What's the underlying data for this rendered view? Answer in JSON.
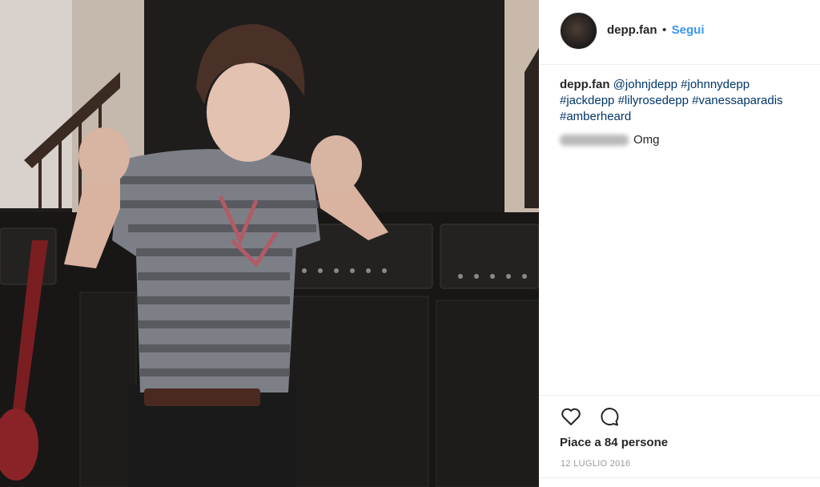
{
  "post": {
    "username": "depp.fan",
    "separator": "•",
    "follow_label": "Segui"
  },
  "caption": {
    "username": "depp.fan",
    "tags": [
      "@johnjdepp",
      "#johnnydepp",
      "#jackdepp",
      "#lilyrosedepp",
      "#vanessaparadis",
      "#amberheard"
    ]
  },
  "comment": {
    "text": "Omg"
  },
  "actions": {
    "like_icon": "heart-outline-icon",
    "comment_icon": "speech-bubble-icon"
  },
  "likes_text": "Piace a 84 persone",
  "date_text": "12 LUGLIO 2016",
  "colors": {
    "link_blue": "#3897f0",
    "hashtag": "#003569",
    "text": "#262626",
    "muted": "#999999"
  }
}
